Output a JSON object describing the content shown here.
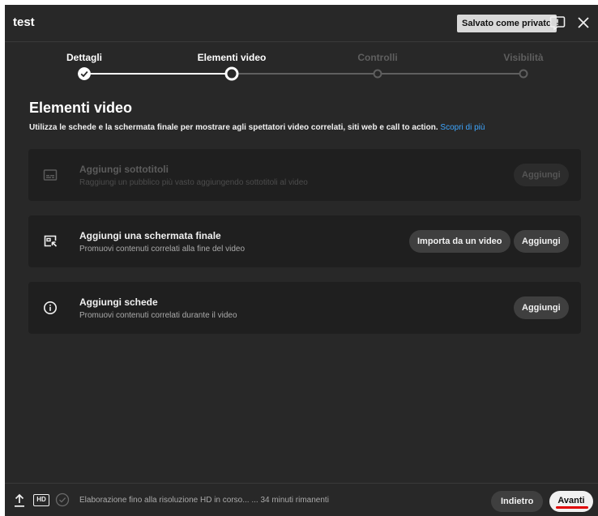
{
  "header": {
    "title": "test",
    "saved_badge": "Salvato come privato"
  },
  "steps": [
    {
      "label": "Dettagli",
      "state": "done"
    },
    {
      "label": "Elementi video",
      "state": "current"
    },
    {
      "label": "Controlli",
      "state": "pending"
    },
    {
      "label": "Visibilità",
      "state": "pending"
    }
  ],
  "section": {
    "title": "Elementi video",
    "description": "Utilizza le schede e la schermata finale per mostrare agli spettatori video correlati, siti web e call to action.",
    "link": "Scopri di più"
  },
  "cards": {
    "subtitles": {
      "title": "Aggiungi sottotitoli",
      "subtitle": "Raggiungi un pubblico più vasto aggiungendo sottotitoli al video",
      "add_label": "Aggiungi",
      "icon": "subtitles-icon"
    },
    "endscreen": {
      "title": "Aggiungi una schermata finale",
      "subtitle": "Promuovi contenuti correlati alla fine del video",
      "import_label": "Importa da un video",
      "add_label": "Aggiungi",
      "icon": "end-screen-icon"
    },
    "cards": {
      "title": "Aggiungi schede",
      "subtitle": "Promuovi contenuti correlati durante il video",
      "add_label": "Aggiungi",
      "icon": "info-icon"
    }
  },
  "footer": {
    "status": "Elaborazione fino alla risoluzione HD in corso... ... 34 minuti rimanenti",
    "hd_label": "HD",
    "back_label": "Indietro",
    "next_label": "Avanti"
  },
  "colors": {
    "dialog_bg": "#282828",
    "card_bg": "#1f1f1f",
    "link": "#3ea6ff",
    "next_underline": "#e00000"
  }
}
